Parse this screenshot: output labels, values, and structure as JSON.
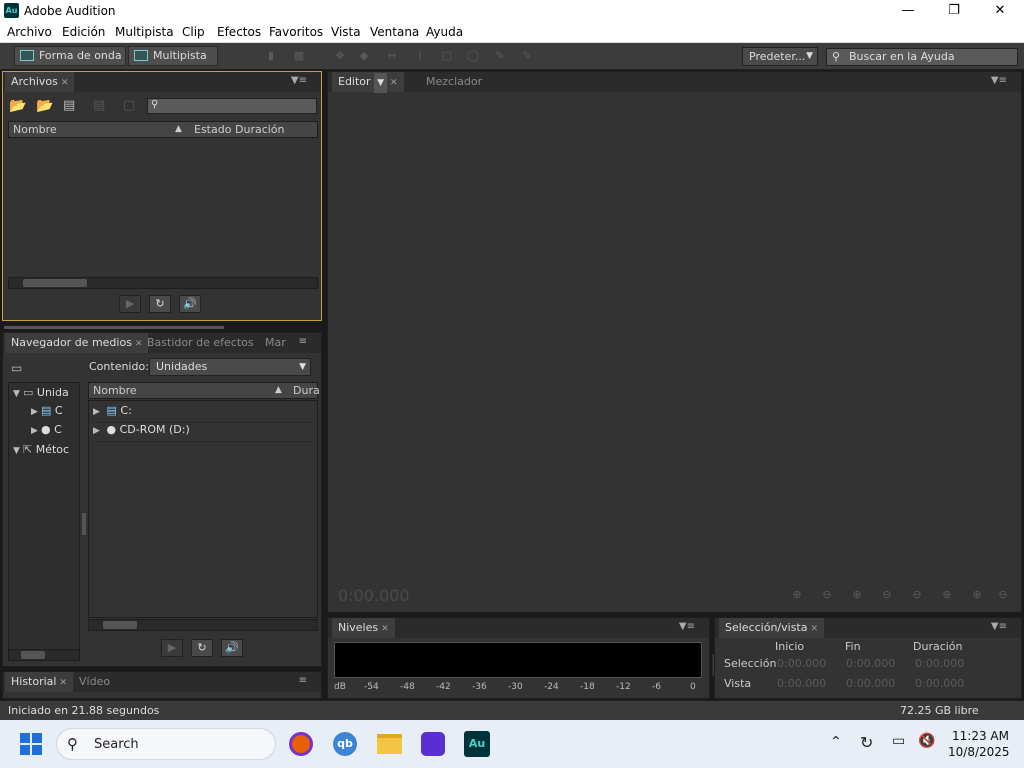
{
  "titlebar": {
    "title": "Adobe Audition",
    "logo": "Au"
  },
  "menu": [
    "Archivo",
    "Edición",
    "Multipista",
    "Clip",
    "Efectos",
    "Favoritos",
    "Vista",
    "Ventana",
    "Ayuda"
  ],
  "toolbar": {
    "waveform_label": "Forma de onda",
    "multitrack_label": "Multipista",
    "workspace_label": "Predeter...",
    "help_search_placeholder": "Buscar en la Ayuda"
  },
  "files_panel": {
    "tab": "Archivos",
    "columns": {
      "name": "Nombre",
      "status": "Estado",
      "duration": "Duración"
    }
  },
  "media_panel": {
    "tabs": [
      "Navegador de medios",
      "Bastidor de efectos",
      "Mar"
    ],
    "content_label": "Contenido:",
    "content_value": "Unidades",
    "left_tree": [
      "Unida",
      "C",
      "C",
      "Métoc"
    ],
    "columns": {
      "name": "Nombre",
      "duration": "Dura"
    },
    "items": [
      "C:",
      "CD-ROM (D:)"
    ]
  },
  "history_panel": {
    "tabs": [
      "Historial",
      "Vídeo"
    ]
  },
  "editor_panel": {
    "tabs": [
      "Editor",
      "Mezclador"
    ],
    "time": "0:00.000"
  },
  "levels_panel": {
    "tab": "Niveles",
    "scale": [
      "dB",
      "-54",
      "-48",
      "-42",
      "-36",
      "-30",
      "-24",
      "-18",
      "-12",
      "-6",
      "0"
    ]
  },
  "selection_panel": {
    "tab": "Selección/vista",
    "headers": {
      "start": "Inicio",
      "end": "Fin",
      "duration": "Duración"
    },
    "rows": [
      {
        "label": "Selección",
        "start": "0:00.000",
        "end": "0:00.000",
        "duration": "0:00.000"
      },
      {
        "label": "Vista",
        "start": "0:00.000",
        "end": "0:00.000",
        "duration": "0:00.000"
      }
    ]
  },
  "status": {
    "left": "Iniciado en 21.88 segundos",
    "free": "72.25 GB libre"
  },
  "taskbar": {
    "search": "Search",
    "time": "11:23 AM",
    "date": "10/8/2025",
    "apps": [
      "firefox-icon",
      "qbittorrent-icon",
      "file-explorer-icon",
      "media-player-icon",
      "audition-icon"
    ]
  },
  "colors": {
    "accent_gold": "#c8a040",
    "record_red": "#c03030",
    "bg": "#333333"
  }
}
